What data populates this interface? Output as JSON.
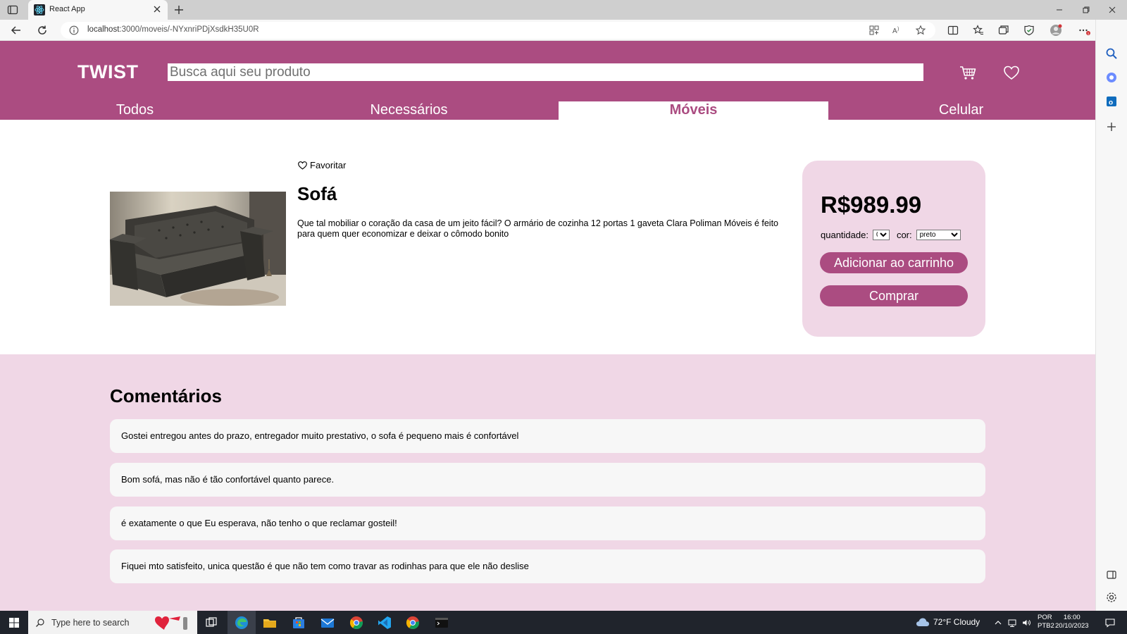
{
  "browser": {
    "tab_title": "React App",
    "url_host": "localhost",
    "url_path": ":3000/moveis/-NYxnriPDjXsdkH35U0R"
  },
  "header": {
    "logo": "TWIST",
    "search_placeholder": "Busca aqui seu produto",
    "cart_icon": "cart-icon",
    "favorites_icon": "heart-icon"
  },
  "nav": {
    "categories": [
      {
        "label": "Todos",
        "active": false
      },
      {
        "label": "Necessários",
        "active": false
      },
      {
        "label": "Móveis",
        "active": true
      },
      {
        "label": "Celular",
        "active": false
      }
    ]
  },
  "product": {
    "favorite_label": "Favoritar",
    "title": "Sofá",
    "description": "Que tal mobiliar o coração da casa de um jeito fácil? O armário de cozinha 12 portas 1 gaveta Clara Poliman Móveis é feito para quem quer economizar e deixar o cômodo bonito",
    "price": "R$989.99",
    "quantity_label": "quantidade:",
    "quantity_value": "0",
    "color_label": "cor:",
    "color_value": "preto",
    "add_to_cart_label": "Adicionar ao carrinho",
    "buy_label": "Comprar"
  },
  "comments": {
    "title": "Comentários",
    "items": [
      "Gostei entregou antes do prazo, entregador muito prestativo, o sofa é pequeno mais é confortável",
      "Bom sofá, mas não é tão confortável quanto parece.",
      "é exatamente o que Eu esperava, não tenho o que reclamar gosteil!",
      "Fiquei mto satisfeito, unica questão é que não tem como travar as rodinhas para que ele não deslise"
    ]
  },
  "taskbar": {
    "search_placeholder": "Type here to search",
    "weather": "72°F Cloudy",
    "lang_1": "POR",
    "lang_2": "PTB2",
    "time": "16:00",
    "date": "20/10/2023"
  },
  "colors": {
    "brand": "#ab4c81",
    "brand_light": "#f0d7e6",
    "comment_bg": "#f7f7f7"
  }
}
